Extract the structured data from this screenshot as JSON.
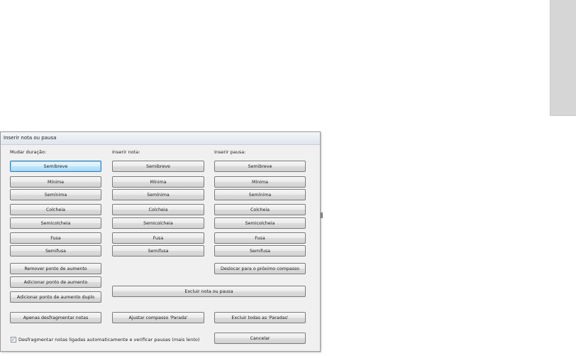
{
  "dialog": {
    "title": "Inserir nota ou pausa",
    "columns": {
      "duration": {
        "label": "Mudar duração:",
        "buttons": [
          "Semibreve",
          "Mínima",
          "Semínima",
          "Colcheia",
          "Semicolcheia",
          "Fusa",
          "Semifusa"
        ]
      },
      "notes": {
        "label": "Inserir nota:",
        "buttons": [
          "Semibreve",
          "Mínima",
          "Semínima",
          "Colcheia",
          "Semicolcheia",
          "Fusa",
          "Semifusa"
        ]
      },
      "rests": {
        "label": "Inserir pausa:",
        "buttons": [
          "Semibreve",
          "Mínima",
          "Semínima",
          "Colcheia",
          "Semicolcheia",
          "Fusa",
          "Semifusa"
        ]
      }
    },
    "dots": {
      "remove": "Remover ponto de aumento",
      "add": "Adicionar ponto de aumento",
      "add_double": "Adicionar ponto de aumento duplo"
    },
    "move_next_measure": "Deslocar para o próximo compasso",
    "delete_note_or_rest": "Excluir nota ou pausa",
    "defragment_only": "Apenas desfragmentar notas",
    "adjust_measure": "Ajustar compasso 'Parada'",
    "delete_all_stops": "Excluir todas as 'Paradas'",
    "auto_defragment": {
      "label": "Desfragmentar notas ligadas automaticamente e verificar pausas (mais lento)",
      "checked": true
    },
    "cancel": "Cancelar"
  }
}
